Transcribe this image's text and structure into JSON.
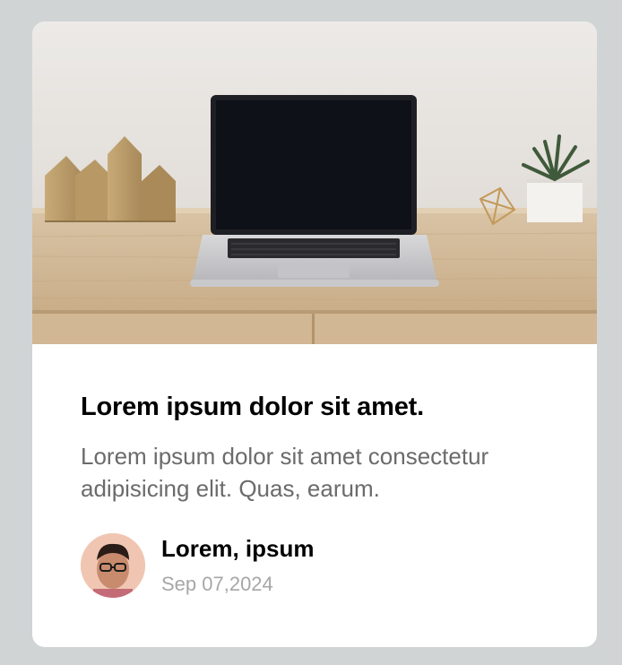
{
  "card": {
    "title": "Lorem ipsum dolor sit amet.",
    "description": "Lorem ipsum dolor sit amet consectetur adipisicing elit. Quas, earum.",
    "author": {
      "name": "Lorem, ipsum",
      "date": "Sep 07,2024"
    }
  },
  "colors": {
    "page_background": "#d0d4d5",
    "card_background": "#ffffff",
    "title_text": "#000000",
    "description_text": "#6b6b6b",
    "date_text": "#a7a7a7"
  }
}
